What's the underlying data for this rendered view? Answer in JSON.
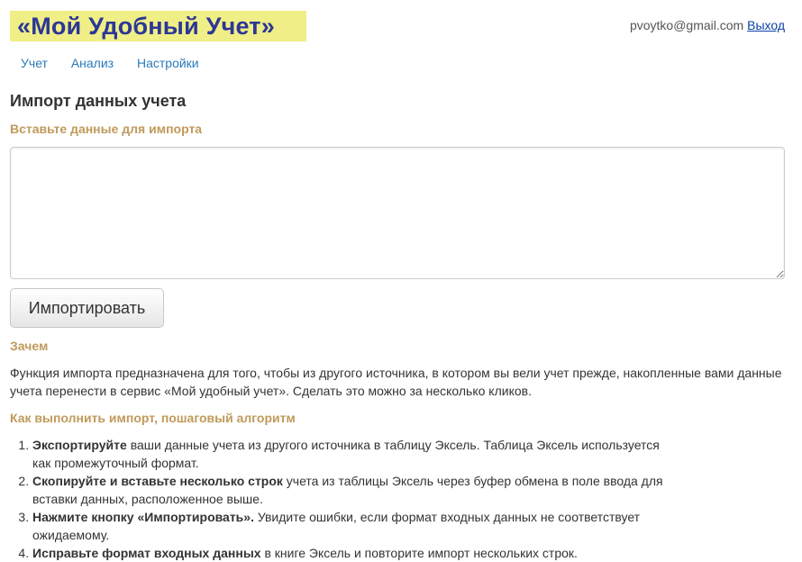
{
  "header": {
    "logo": "«Мой Удобный Учет»",
    "user_email": "pvoytko@gmail.com",
    "logout": "Выход"
  },
  "nav": {
    "items": [
      "Учет",
      "Анализ",
      "Настройки"
    ]
  },
  "main": {
    "title": "Импорт данных учета",
    "paste_label": "Вставьте данные для импорта",
    "textarea_value": "",
    "import_button": "Импортировать",
    "why_heading": "Зачем",
    "why_text": "Функция импорта предназначена для того, чтобы из другого источника, в котором вы вели учет прежде, накопленные вами данные учета перенести в сервис «Мой удобный учет». Сделать это можно за несколько кликов.",
    "how_heading": "Как выполнить импорт, пошаговый алгоритм",
    "steps": [
      {
        "bold": "Экспортируйте",
        "rest": " ваши данные учета из другого источника в таблицу Эксель. Таблица Эксель используется как промежуточный формат."
      },
      {
        "bold": "Скопируйте и вставьте несколько строк",
        "rest": " учета из таблицы Эксель через буфер обмена в поле ввода для вставки данных, расположенное выше."
      },
      {
        "bold": "Нажмите кнопку «Импортировать».",
        "rest": " Увидите ошибки, если формат входных данных не соответствует ожидаемому."
      },
      {
        "bold": "Исправьте формат входных данных",
        "rest": " в книге Эксель и повторите импорт нескольких строк."
      }
    ]
  }
}
